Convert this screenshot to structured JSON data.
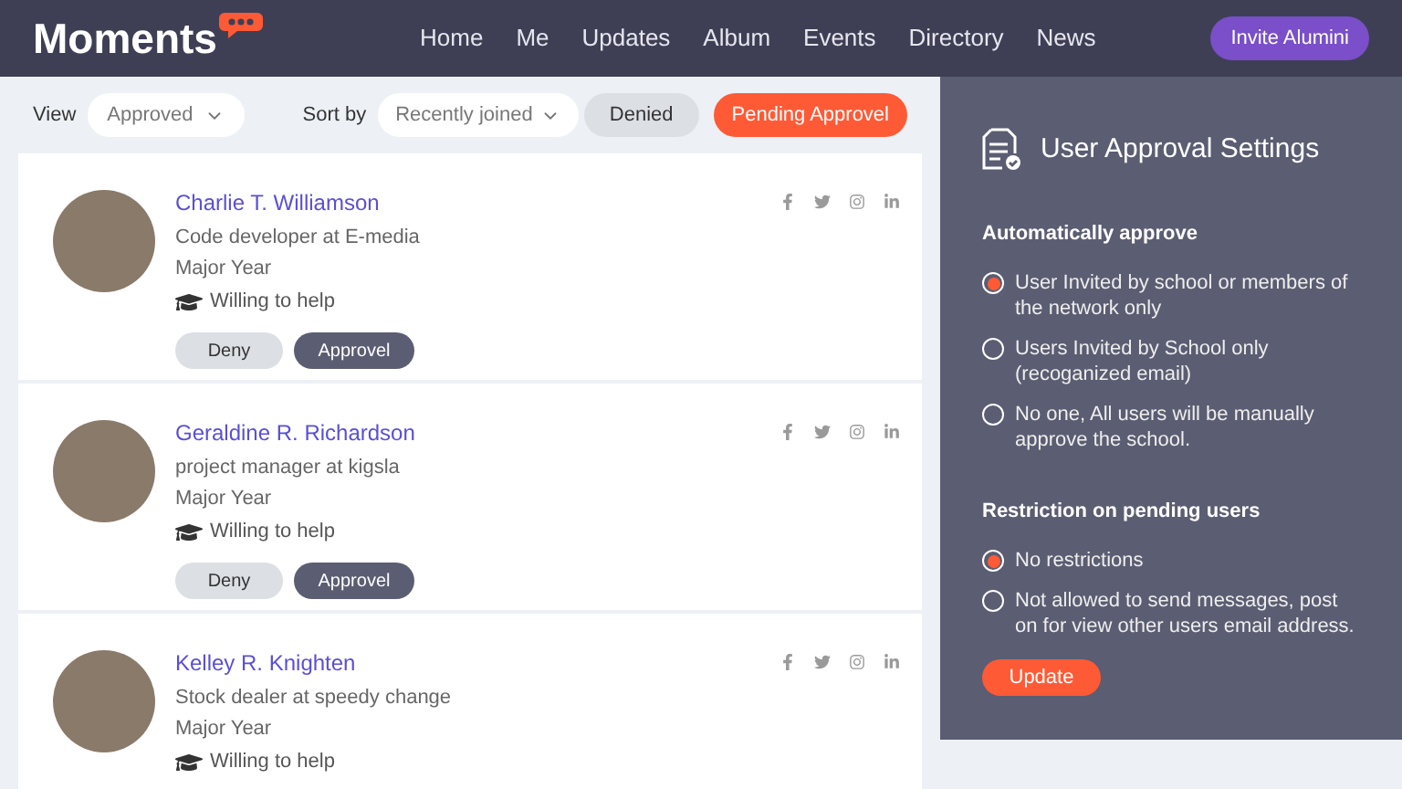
{
  "header": {
    "logo": "Moments",
    "nav": [
      "Home",
      "Me",
      "Updates",
      "Album",
      "Events",
      "Directory",
      "News"
    ],
    "invite_button": "Invite Alumini"
  },
  "filters": {
    "view_label": "View",
    "view_value": "Approved",
    "sort_label": "Sort by",
    "sort_value": "Recently joined",
    "tabs": [
      {
        "label": "Denied",
        "selected": false
      },
      {
        "label": "Pending Approvel",
        "selected": true
      }
    ]
  },
  "users": [
    {
      "name": "Charlie T. Williamson",
      "role": "Code developer at E-media",
      "year": "Major Year",
      "help": "Willing to help",
      "actions": [
        "Deny",
        "Approvel"
      ]
    },
    {
      "name": "Geraldine R. Richardson",
      "role": "project manager at kigsla",
      "year": "Major Year",
      "help": "Willing to help",
      "actions": [
        "Deny",
        "Approvel"
      ]
    },
    {
      "name": "Kelley R. Knighten",
      "role": "Stock dealer at speedy change",
      "year": "Major Year",
      "help": "Willing to help"
    }
  ],
  "settings": {
    "title": "User Approval Settings",
    "groups": [
      {
        "heading": "Automatically approve",
        "options": [
          {
            "label": "User Invited by school or members of the network only",
            "selected": true
          },
          {
            "label": "Users Invited by School only (recoganized email)",
            "selected": false
          },
          {
            "label": "No one, All users will be manually approve the school.",
            "selected": false
          }
        ]
      },
      {
        "heading": "Restriction on pending users",
        "options": [
          {
            "label": "No restrictions",
            "selected": true
          },
          {
            "label": "Not allowed to send messages, post on for view other users email address.",
            "selected": false
          }
        ]
      }
    ],
    "update_button": "Update"
  }
}
